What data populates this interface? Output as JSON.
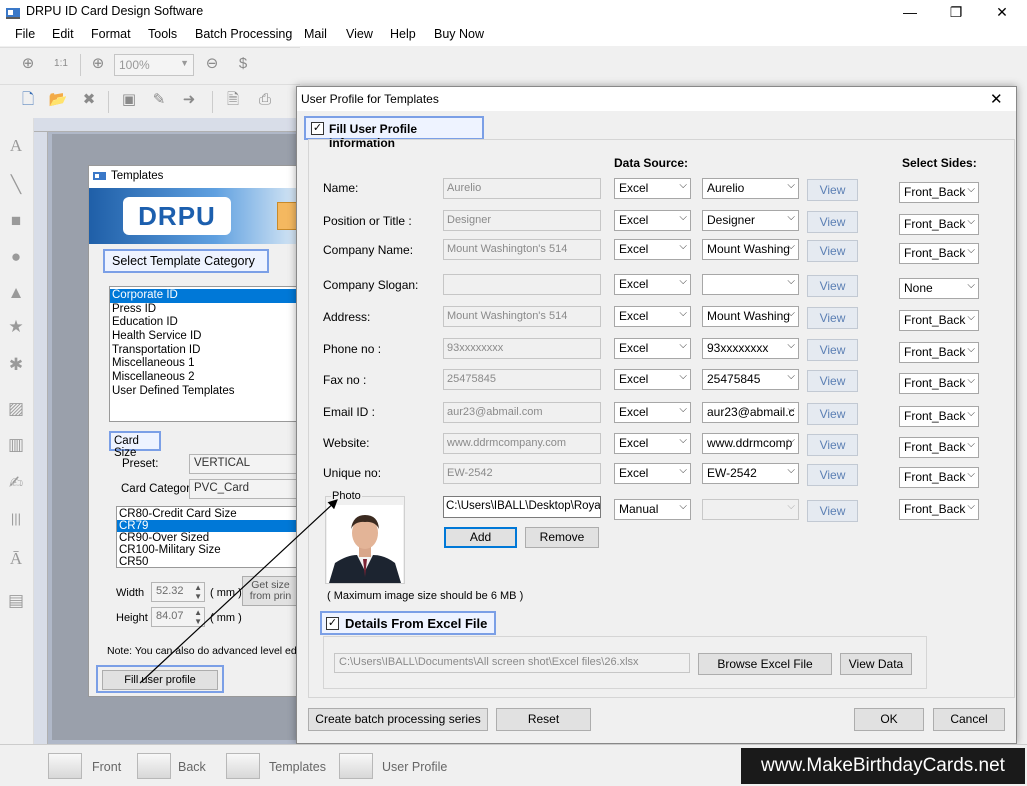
{
  "app": {
    "title": "DRPU ID Card Design Software",
    "window_controls": {
      "minimize": "—",
      "maximize": "❐",
      "close": "✕"
    }
  },
  "menu": [
    "File",
    "Edit",
    "Format",
    "Tools",
    "Batch Processing",
    "Mail",
    "View",
    "Help",
    "Buy Now"
  ],
  "toolbar": {
    "zoom_value": "100%"
  },
  "templates_window": {
    "title": "Templates",
    "logo": "DRPU",
    "select_category_label": "Select Template Category",
    "categories": [
      "Corporate ID",
      "Press ID",
      "Education ID",
      "Health Service ID",
      "Transportation ID",
      "Miscellaneous 1",
      "Miscellaneous 2",
      "User Defined Templates"
    ],
    "selected_category": 0,
    "card_size_label": "Card Size",
    "preset_label": "Preset:",
    "preset_value": "VERTICAL",
    "card_category_label": "Card Category",
    "card_category_value": "PVC_Card",
    "sizes": [
      "CR80-Credit Card Size",
      "CR79",
      "CR90-Over Sized",
      "CR100-Military Size",
      "CR50"
    ],
    "selected_size": 1,
    "width_label": "Width",
    "width_value": "52.32",
    "height_label": "Height",
    "height_value": "84.07",
    "unit": "( mm )",
    "get_size_button": "Get size from prin",
    "note": "Note: You can also do advanced level editi",
    "fill_profile_button": "Fill user profile"
  },
  "dialog": {
    "title": "User Profile for Templates",
    "fill_checkbox_label": "Fill User Profile Information",
    "data_source_header": "Data Source:",
    "select_sides_header": "Select Sides:",
    "view_label": "View",
    "rows": [
      {
        "label": "Name:",
        "value": "Aurelio",
        "source": "Excel",
        "column": "Aurelio",
        "side": "Front_Back"
      },
      {
        "label": "Position or Title :",
        "value": "Designer",
        "source": "Excel",
        "column": "Designer",
        "side": "Front_Back"
      },
      {
        "label": "Company Name:",
        "value": "Mount Washington's 514",
        "source": "Excel",
        "column": "Mount Washing",
        "side": "Front_Back"
      },
      {
        "label": "Company Slogan:",
        "value": "",
        "source": "Excel",
        "column": "",
        "side": "None"
      },
      {
        "label": "Address:",
        "value": "Mount Washington's 514",
        "source": "Excel",
        "column": "Mount Washing",
        "side": "Front_Back"
      },
      {
        "label": "Phone no :",
        "value": "93xxxxxxxx",
        "source": "Excel",
        "column": "93xxxxxxxx",
        "side": "Front_Back"
      },
      {
        "label": "Fax no :",
        "value": "25475845",
        "source": "Excel",
        "column": "25475845",
        "side": "Front_Back"
      },
      {
        "label": "Email ID :",
        "value": "aur23@abmail.com",
        "source": "Excel",
        "column": "aur23@abmail.c",
        "side": "Front_Back"
      },
      {
        "label": "Website:",
        "value": "www.ddrmcompany.com",
        "source": "Excel",
        "column": "www.ddrmcomp",
        "side": "Front_Back"
      },
      {
        "label": "Unique no:",
        "value": "EW-2542",
        "source": "Excel",
        "column": "EW-2542",
        "side": "Front_Back"
      }
    ],
    "photo": {
      "label": "Photo",
      "path": "C:\\Users\\IBALL\\Desktop\\Roya",
      "source": "Manual",
      "column": "",
      "side": "Front_Back",
      "add_button": "Add",
      "remove_button": "Remove",
      "max_size_note": "( Maximum image size should be 6 MB )"
    },
    "excel": {
      "checkbox_label": "Details From Excel File",
      "path": "C:\\Users\\IBALL\\Documents\\All screen shot\\Excel files\\26.xlsx",
      "browse_button": "Browse Excel File",
      "view_data_button": "View Data"
    },
    "buttons": {
      "batch": "Create batch processing series",
      "reset": "Reset",
      "ok": "OK",
      "cancel": "Cancel"
    }
  },
  "status_tabs": [
    "Front",
    "Back",
    "Templates",
    "User Profile"
  ],
  "watermark": "www.MakeBirthdayCards.net"
}
